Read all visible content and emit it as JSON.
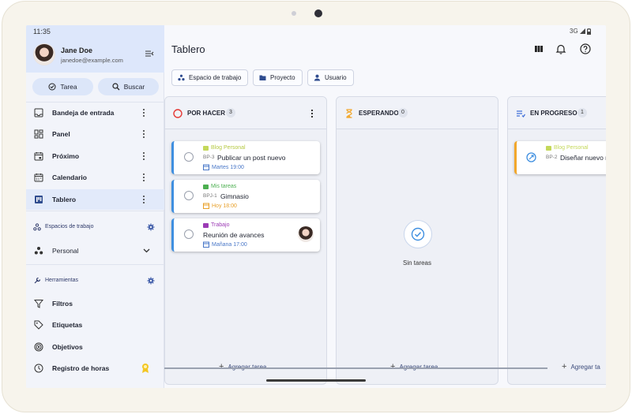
{
  "status": {
    "time": "11:35",
    "network": "3G"
  },
  "user": {
    "name": "Jane Doe",
    "email": "janedoe@example.com"
  },
  "actions": {
    "task_label": "Tarea",
    "search_label": "Buscar"
  },
  "nav": [
    {
      "label": "Bandeja de entrada",
      "icon": "inbox-icon"
    },
    {
      "label": "Panel",
      "icon": "dashboard-icon"
    },
    {
      "label": "Próximo",
      "icon": "calendar-next-icon"
    },
    {
      "label": "Calendario",
      "icon": "calendar-icon"
    },
    {
      "label": "Tablero",
      "icon": "board-icon",
      "active": true
    }
  ],
  "workspaces": {
    "title": "Espacios de trabajo",
    "items": [
      {
        "label": "Personal"
      }
    ]
  },
  "tools": {
    "title": "Herramientas",
    "items": [
      {
        "label": "Filtros",
        "icon": "filter-icon"
      },
      {
        "label": "Etiquetas",
        "icon": "tag-icon"
      },
      {
        "label": "Objetivos",
        "icon": "target-icon"
      },
      {
        "label": "Registro de horas",
        "icon": "clock-icon"
      }
    ]
  },
  "page": {
    "title": "Tablero"
  },
  "filters": {
    "workspace": "Espacio de trabajo",
    "project": "Proyecto",
    "user": "Usuario"
  },
  "columns": [
    {
      "title": "POR HACER",
      "count": "3",
      "tasks": [
        {
          "project": "Blog Personal",
          "code": "BP-3",
          "title": "Publicar un post nuevo",
          "date": "Martes 19:00"
        },
        {
          "project": "Mis tareas",
          "code": "BPJ-1",
          "title": "Gimnasio",
          "date": "Hoy 18:00"
        },
        {
          "project": "Trabajo",
          "code": "",
          "title": "Reunión de avances",
          "date": "Mañana 17:00"
        }
      ],
      "add": "Agregar tarea"
    },
    {
      "title": "ESPERANDO",
      "count": "0",
      "empty": "Sin tareas",
      "add": "Agregar tarea"
    },
    {
      "title": "EN PROGRESO",
      "count": "1",
      "tasks": [
        {
          "project": "Blog Personal",
          "code": "BP-2",
          "title": "Diseñar nuevo r"
        }
      ],
      "add": "Agregar ta"
    }
  ],
  "colors": {
    "accent": "#3f8fe0",
    "todo": "#e53935",
    "waiting": "#f2a72b",
    "in_progress": "#3f6fd8",
    "project_blog": "#c4d85a",
    "project_mine": "#4caf50",
    "project_work": "#9c3bb5",
    "date_blue": "#4a78c8",
    "date_orange": "#e8a02a"
  }
}
